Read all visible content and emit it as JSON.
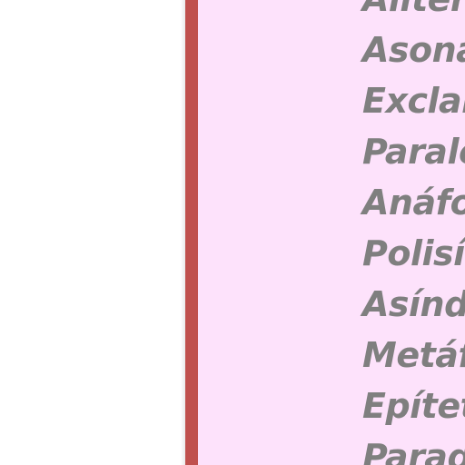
{
  "slide": {
    "terms": [
      "Aliteración",
      "Asonancia",
      "Exclamación",
      "Paralelismo",
      "Anáfora",
      "Polisíndeton",
      "Asíndeton",
      "Metáfora",
      "Epíteto",
      "Paradoja"
    ]
  },
  "colors": {
    "accent_bar": "#c0504d",
    "panel_background": "#fde2fb",
    "text": "#7f7f7f"
  }
}
